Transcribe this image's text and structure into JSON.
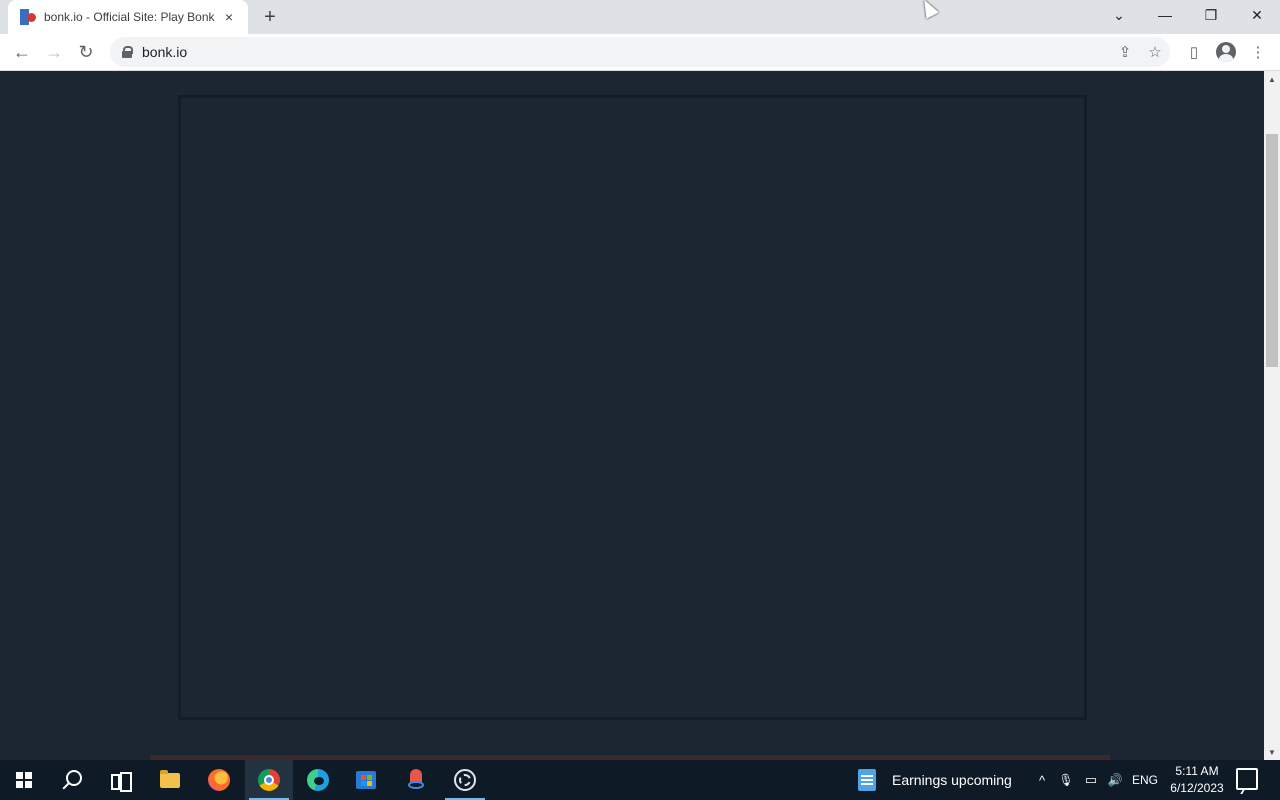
{
  "browser": {
    "tab": {
      "title": "bonk.io - Official Site: Play Bonk",
      "close_icon": "×"
    },
    "new_tab_icon": "+",
    "window_controls": {
      "tabsearch_icon": "⌄",
      "minimize_icon": "—",
      "restore_icon": "❐",
      "close_icon": "✕"
    },
    "toolbar": {
      "back_icon": "←",
      "forward_icon": "→",
      "reload_icon": "↻",
      "url": "bonk.io",
      "share_icon": "⇪",
      "bookmark_icon": "☆",
      "sidepanel_icon": "▯",
      "menu_icon": "⋮"
    },
    "scrollbar": {
      "up_icon": "▲",
      "down_icon": "▼"
    }
  },
  "page": {
    "background_color": "#1c2633",
    "game_frame_color": "#1c2633"
  },
  "taskbar": {
    "news": {
      "label": "Earnings upcoming"
    },
    "tray": {
      "chevron_icon": "^",
      "mic_icon": "🎙",
      "network_icon": "▭",
      "volume_icon": "🔊",
      "language": "ENG"
    },
    "clock": {
      "time": "5:11 AM",
      "date": "6/12/2023"
    }
  }
}
